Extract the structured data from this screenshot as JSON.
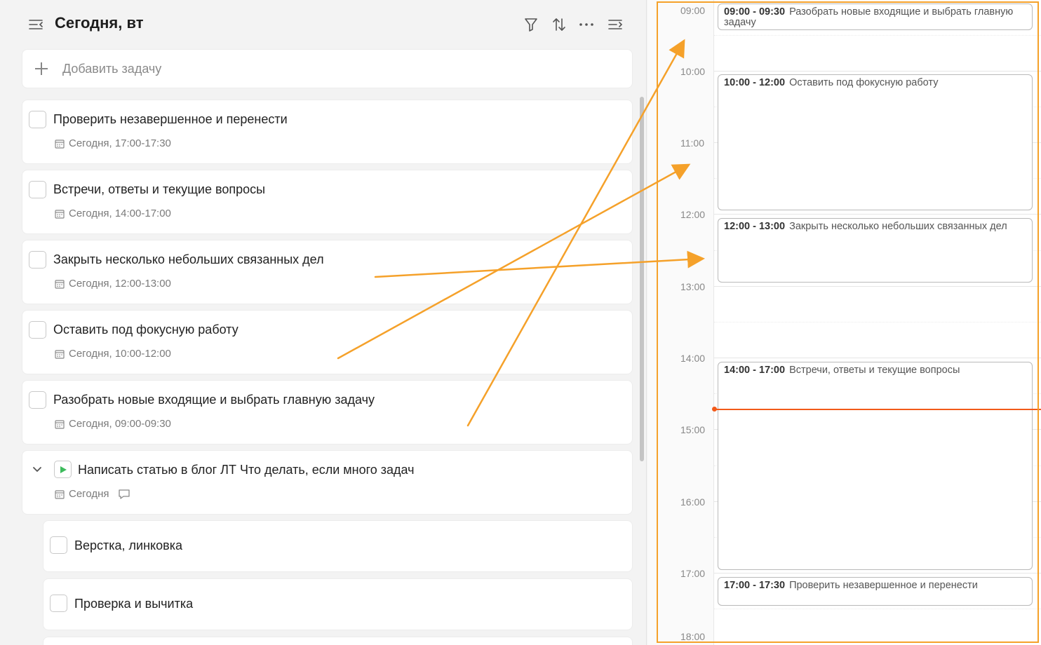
{
  "header": {
    "title": "Сегодня, вт",
    "icons": [
      "collapse-left-icon",
      "filter-icon",
      "sort-icon",
      "more-icon",
      "collapse-right-icon"
    ]
  },
  "add_task": {
    "placeholder": "Добавить задачу"
  },
  "tasks": [
    {
      "title": "Проверить незавершенное и перенести",
      "date": "Сегодня, 17:00-17:30"
    },
    {
      "title": "Встречи, ответы и текущие вопросы",
      "date": "Сегодня, 14:00-17:00"
    },
    {
      "title": "Закрыть несколько небольших связанных дел",
      "date": "Сегодня, 12:00-13:00"
    },
    {
      "title": "Оставить под фокусную работу",
      "date": "Сегодня, 10:00-12:00"
    },
    {
      "title": "Разобрать новые входящие и выбрать главную задачу",
      "date": "Сегодня, 09:00-09:30"
    }
  ],
  "project": {
    "title": "Написать статью в блог ЛТ Что делать, если много задач",
    "date": "Сегодня",
    "subtasks": [
      {
        "title": "Верстка, линковка"
      },
      {
        "title": "Проверка и вычитка"
      }
    ]
  },
  "calendar": {
    "hours": [
      "09:00",
      "10:00",
      "11:00",
      "12:00",
      "13:00",
      "14:00",
      "15:00",
      "16:00",
      "17:00",
      "18:00"
    ],
    "events": [
      {
        "time": "09:00 - 09:30",
        "title": "Разобрать новые входящие и выбрать главную задачу"
      },
      {
        "time": "10:00 - 12:00",
        "title": "Оставить под фокусную работу"
      },
      {
        "time": "12:00 - 13:00",
        "title": "Закрыть несколько небольших связанных дел"
      },
      {
        "time": "14:00 - 17:00",
        "title": "Встречи, ответы и текущие вопросы"
      },
      {
        "time": "17:00 - 17:30",
        "title": "Проверить незавершенное и перенести"
      }
    ]
  },
  "colors": {
    "annotation": "#f5a12a",
    "now_line": "#f25a1a",
    "play": "#3dbb5c"
  }
}
